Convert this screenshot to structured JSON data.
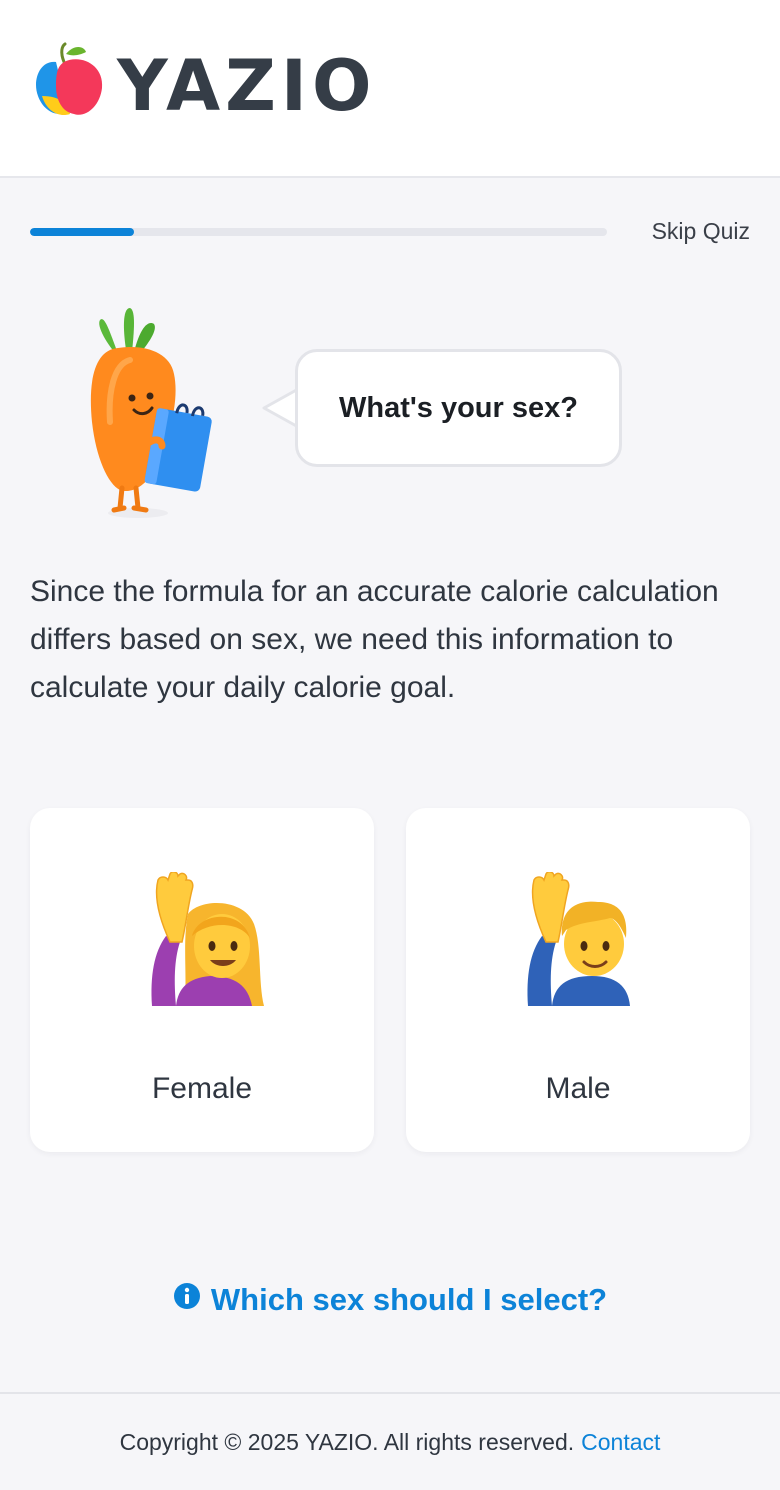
{
  "header": {
    "logo_text": "YAZIO"
  },
  "quiz": {
    "progress_fraction": 0.18,
    "skip_label": "Skip Quiz",
    "question": "What's your sex?",
    "explanation": "Since the formula for an accurate calorie calculation differs based on sex, we need this information to calculate your daily calorie goal.",
    "options": [
      {
        "label": "Female",
        "icon": "woman-raising-hand-emoji"
      },
      {
        "label": "Male",
        "icon": "man-raising-hand-emoji"
      }
    ],
    "help_link": "Which sex should I select?"
  },
  "footer": {
    "copyright": "Copyright © 2025 YAZIO. All rights reserved.",
    "contact_label": "Contact"
  },
  "colors": {
    "accent": "#0c83d8",
    "background": "#f6f6f9",
    "text": "#2f3640"
  }
}
